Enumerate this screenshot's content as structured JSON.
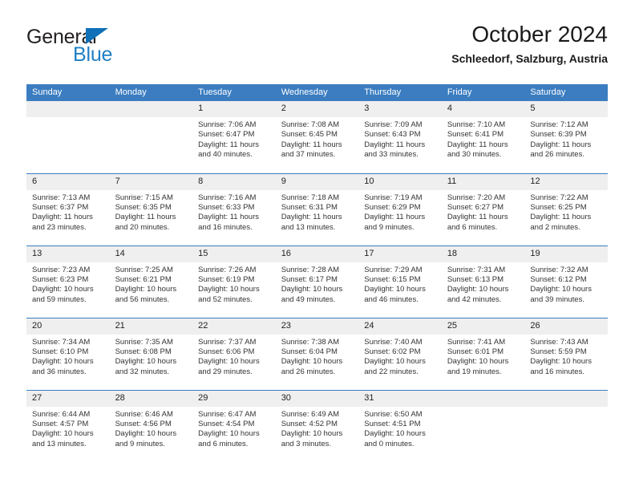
{
  "brand": {
    "name_part1": "General",
    "name_part2": "Blue",
    "triangle_icon": "triangle-icon",
    "color_dark": "#231f20",
    "color_blue": "#1f7fc4"
  },
  "header": {
    "month_year": "October 2024",
    "location": "Schleedorf, Salzburg, Austria"
  },
  "theme": {
    "header_blue": "#3b7dc0",
    "daynum_gray": "#efefef",
    "text": "#333333"
  },
  "weekday_headers": [
    "Sunday",
    "Monday",
    "Tuesday",
    "Wednesday",
    "Thursday",
    "Friday",
    "Saturday"
  ],
  "weeks": [
    [
      {
        "day": "",
        "empty": true
      },
      {
        "day": "",
        "empty": true
      },
      {
        "day": "1",
        "sunrise": "Sunrise: 7:06 AM",
        "sunset": "Sunset: 6:47 PM",
        "daylight1": "Daylight: 11 hours",
        "daylight2": "and 40 minutes."
      },
      {
        "day": "2",
        "sunrise": "Sunrise: 7:08 AM",
        "sunset": "Sunset: 6:45 PM",
        "daylight1": "Daylight: 11 hours",
        "daylight2": "and 37 minutes."
      },
      {
        "day": "3",
        "sunrise": "Sunrise: 7:09 AM",
        "sunset": "Sunset: 6:43 PM",
        "daylight1": "Daylight: 11 hours",
        "daylight2": "and 33 minutes."
      },
      {
        "day": "4",
        "sunrise": "Sunrise: 7:10 AM",
        "sunset": "Sunset: 6:41 PM",
        "daylight1": "Daylight: 11 hours",
        "daylight2": "and 30 minutes."
      },
      {
        "day": "5",
        "sunrise": "Sunrise: 7:12 AM",
        "sunset": "Sunset: 6:39 PM",
        "daylight1": "Daylight: 11 hours",
        "daylight2": "and 26 minutes."
      }
    ],
    [
      {
        "day": "6",
        "sunrise": "Sunrise: 7:13 AM",
        "sunset": "Sunset: 6:37 PM",
        "daylight1": "Daylight: 11 hours",
        "daylight2": "and 23 minutes."
      },
      {
        "day": "7",
        "sunrise": "Sunrise: 7:15 AM",
        "sunset": "Sunset: 6:35 PM",
        "daylight1": "Daylight: 11 hours",
        "daylight2": "and 20 minutes."
      },
      {
        "day": "8",
        "sunrise": "Sunrise: 7:16 AM",
        "sunset": "Sunset: 6:33 PM",
        "daylight1": "Daylight: 11 hours",
        "daylight2": "and 16 minutes."
      },
      {
        "day": "9",
        "sunrise": "Sunrise: 7:18 AM",
        "sunset": "Sunset: 6:31 PM",
        "daylight1": "Daylight: 11 hours",
        "daylight2": "and 13 minutes."
      },
      {
        "day": "10",
        "sunrise": "Sunrise: 7:19 AM",
        "sunset": "Sunset: 6:29 PM",
        "daylight1": "Daylight: 11 hours",
        "daylight2": "and 9 minutes."
      },
      {
        "day": "11",
        "sunrise": "Sunrise: 7:20 AM",
        "sunset": "Sunset: 6:27 PM",
        "daylight1": "Daylight: 11 hours",
        "daylight2": "and 6 minutes."
      },
      {
        "day": "12",
        "sunrise": "Sunrise: 7:22 AM",
        "sunset": "Sunset: 6:25 PM",
        "daylight1": "Daylight: 11 hours",
        "daylight2": "and 2 minutes."
      }
    ],
    [
      {
        "day": "13",
        "sunrise": "Sunrise: 7:23 AM",
        "sunset": "Sunset: 6:23 PM",
        "daylight1": "Daylight: 10 hours",
        "daylight2": "and 59 minutes."
      },
      {
        "day": "14",
        "sunrise": "Sunrise: 7:25 AM",
        "sunset": "Sunset: 6:21 PM",
        "daylight1": "Daylight: 10 hours",
        "daylight2": "and 56 minutes."
      },
      {
        "day": "15",
        "sunrise": "Sunrise: 7:26 AM",
        "sunset": "Sunset: 6:19 PM",
        "daylight1": "Daylight: 10 hours",
        "daylight2": "and 52 minutes."
      },
      {
        "day": "16",
        "sunrise": "Sunrise: 7:28 AM",
        "sunset": "Sunset: 6:17 PM",
        "daylight1": "Daylight: 10 hours",
        "daylight2": "and 49 minutes."
      },
      {
        "day": "17",
        "sunrise": "Sunrise: 7:29 AM",
        "sunset": "Sunset: 6:15 PM",
        "daylight1": "Daylight: 10 hours",
        "daylight2": "and 46 minutes."
      },
      {
        "day": "18",
        "sunrise": "Sunrise: 7:31 AM",
        "sunset": "Sunset: 6:13 PM",
        "daylight1": "Daylight: 10 hours",
        "daylight2": "and 42 minutes."
      },
      {
        "day": "19",
        "sunrise": "Sunrise: 7:32 AM",
        "sunset": "Sunset: 6:12 PM",
        "daylight1": "Daylight: 10 hours",
        "daylight2": "and 39 minutes."
      }
    ],
    [
      {
        "day": "20",
        "sunrise": "Sunrise: 7:34 AM",
        "sunset": "Sunset: 6:10 PM",
        "daylight1": "Daylight: 10 hours",
        "daylight2": "and 36 minutes."
      },
      {
        "day": "21",
        "sunrise": "Sunrise: 7:35 AM",
        "sunset": "Sunset: 6:08 PM",
        "daylight1": "Daylight: 10 hours",
        "daylight2": "and 32 minutes."
      },
      {
        "day": "22",
        "sunrise": "Sunrise: 7:37 AM",
        "sunset": "Sunset: 6:06 PM",
        "daylight1": "Daylight: 10 hours",
        "daylight2": "and 29 minutes."
      },
      {
        "day": "23",
        "sunrise": "Sunrise: 7:38 AM",
        "sunset": "Sunset: 6:04 PM",
        "daylight1": "Daylight: 10 hours",
        "daylight2": "and 26 minutes."
      },
      {
        "day": "24",
        "sunrise": "Sunrise: 7:40 AM",
        "sunset": "Sunset: 6:02 PM",
        "daylight1": "Daylight: 10 hours",
        "daylight2": "and 22 minutes."
      },
      {
        "day": "25",
        "sunrise": "Sunrise: 7:41 AM",
        "sunset": "Sunset: 6:01 PM",
        "daylight1": "Daylight: 10 hours",
        "daylight2": "and 19 minutes."
      },
      {
        "day": "26",
        "sunrise": "Sunrise: 7:43 AM",
        "sunset": "Sunset: 5:59 PM",
        "daylight1": "Daylight: 10 hours",
        "daylight2": "and 16 minutes."
      }
    ],
    [
      {
        "day": "27",
        "sunrise": "Sunrise: 6:44 AM",
        "sunset": "Sunset: 4:57 PM",
        "daylight1": "Daylight: 10 hours",
        "daylight2": "and 13 minutes."
      },
      {
        "day": "28",
        "sunrise": "Sunrise: 6:46 AM",
        "sunset": "Sunset: 4:56 PM",
        "daylight1": "Daylight: 10 hours",
        "daylight2": "and 9 minutes."
      },
      {
        "day": "29",
        "sunrise": "Sunrise: 6:47 AM",
        "sunset": "Sunset: 4:54 PM",
        "daylight1": "Daylight: 10 hours",
        "daylight2": "and 6 minutes."
      },
      {
        "day": "30",
        "sunrise": "Sunrise: 6:49 AM",
        "sunset": "Sunset: 4:52 PM",
        "daylight1": "Daylight: 10 hours",
        "daylight2": "and 3 minutes."
      },
      {
        "day": "31",
        "sunrise": "Sunrise: 6:50 AM",
        "sunset": "Sunset: 4:51 PM",
        "daylight1": "Daylight: 10 hours",
        "daylight2": "and 0 minutes."
      },
      {
        "day": "",
        "empty": true
      },
      {
        "day": "",
        "empty": true
      }
    ]
  ]
}
